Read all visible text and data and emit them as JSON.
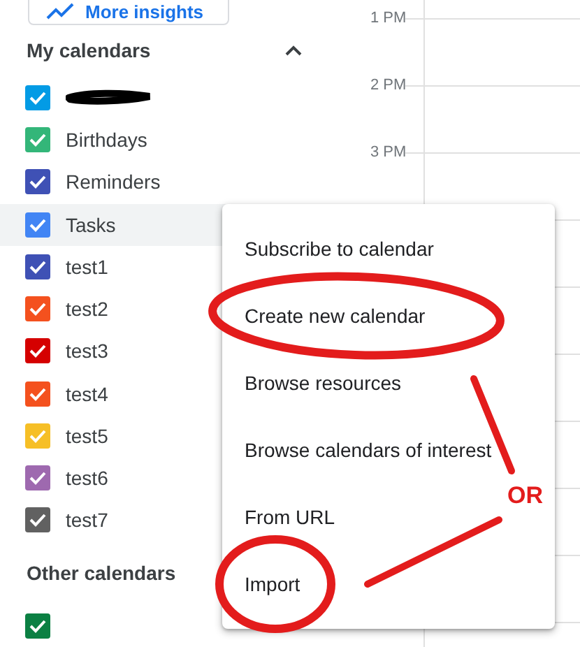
{
  "insights_button": {
    "label": "More insights"
  },
  "my_calendars": {
    "title": "My calendars",
    "expanded": true,
    "items": [
      {
        "redacted": true,
        "checked": true,
        "color": "#039be5",
        "highlighted": false
      },
      {
        "label": "Birthdays",
        "checked": true,
        "color": "#33b679",
        "highlighted": false
      },
      {
        "label": "Reminders",
        "checked": true,
        "color": "#3f51b5",
        "highlighted": false
      },
      {
        "label": "Tasks",
        "checked": true,
        "color": "#4285f4",
        "highlighted": true
      },
      {
        "label": "test1",
        "checked": true,
        "color": "#3f51b5",
        "highlighted": false
      },
      {
        "label": "test2",
        "checked": true,
        "color": "#f4511e",
        "highlighted": false
      },
      {
        "label": "test3",
        "checked": true,
        "color": "#d50000",
        "highlighted": false
      },
      {
        "label": "test4",
        "checked": true,
        "color": "#f4511e",
        "highlighted": false
      },
      {
        "label": "test5",
        "checked": true,
        "color": "#f6bf26",
        "highlighted": false
      },
      {
        "label": "test6",
        "checked": true,
        "color": "#9e69af",
        "highlighted": false
      },
      {
        "label": "test7",
        "checked": true,
        "color": "#616161",
        "highlighted": false
      }
    ]
  },
  "other_calendars": {
    "title": "Other calendars",
    "items": [
      {
        "checked": true,
        "color": "#0b8043"
      }
    ]
  },
  "time_labels": [
    "1 PM",
    "2 PM",
    "3 PM"
  ],
  "menu": {
    "items": [
      {
        "label": "Subscribe to calendar",
        "circled": false
      },
      {
        "label": "Create new calendar",
        "circled": true
      },
      {
        "label": "Browse resources",
        "circled": false
      },
      {
        "label": "Browse calendars of interest",
        "circled": false
      },
      {
        "label": "From URL",
        "circled": false
      },
      {
        "label": "Import",
        "circled": true
      }
    ]
  },
  "annotation": {
    "text": "OR"
  }
}
